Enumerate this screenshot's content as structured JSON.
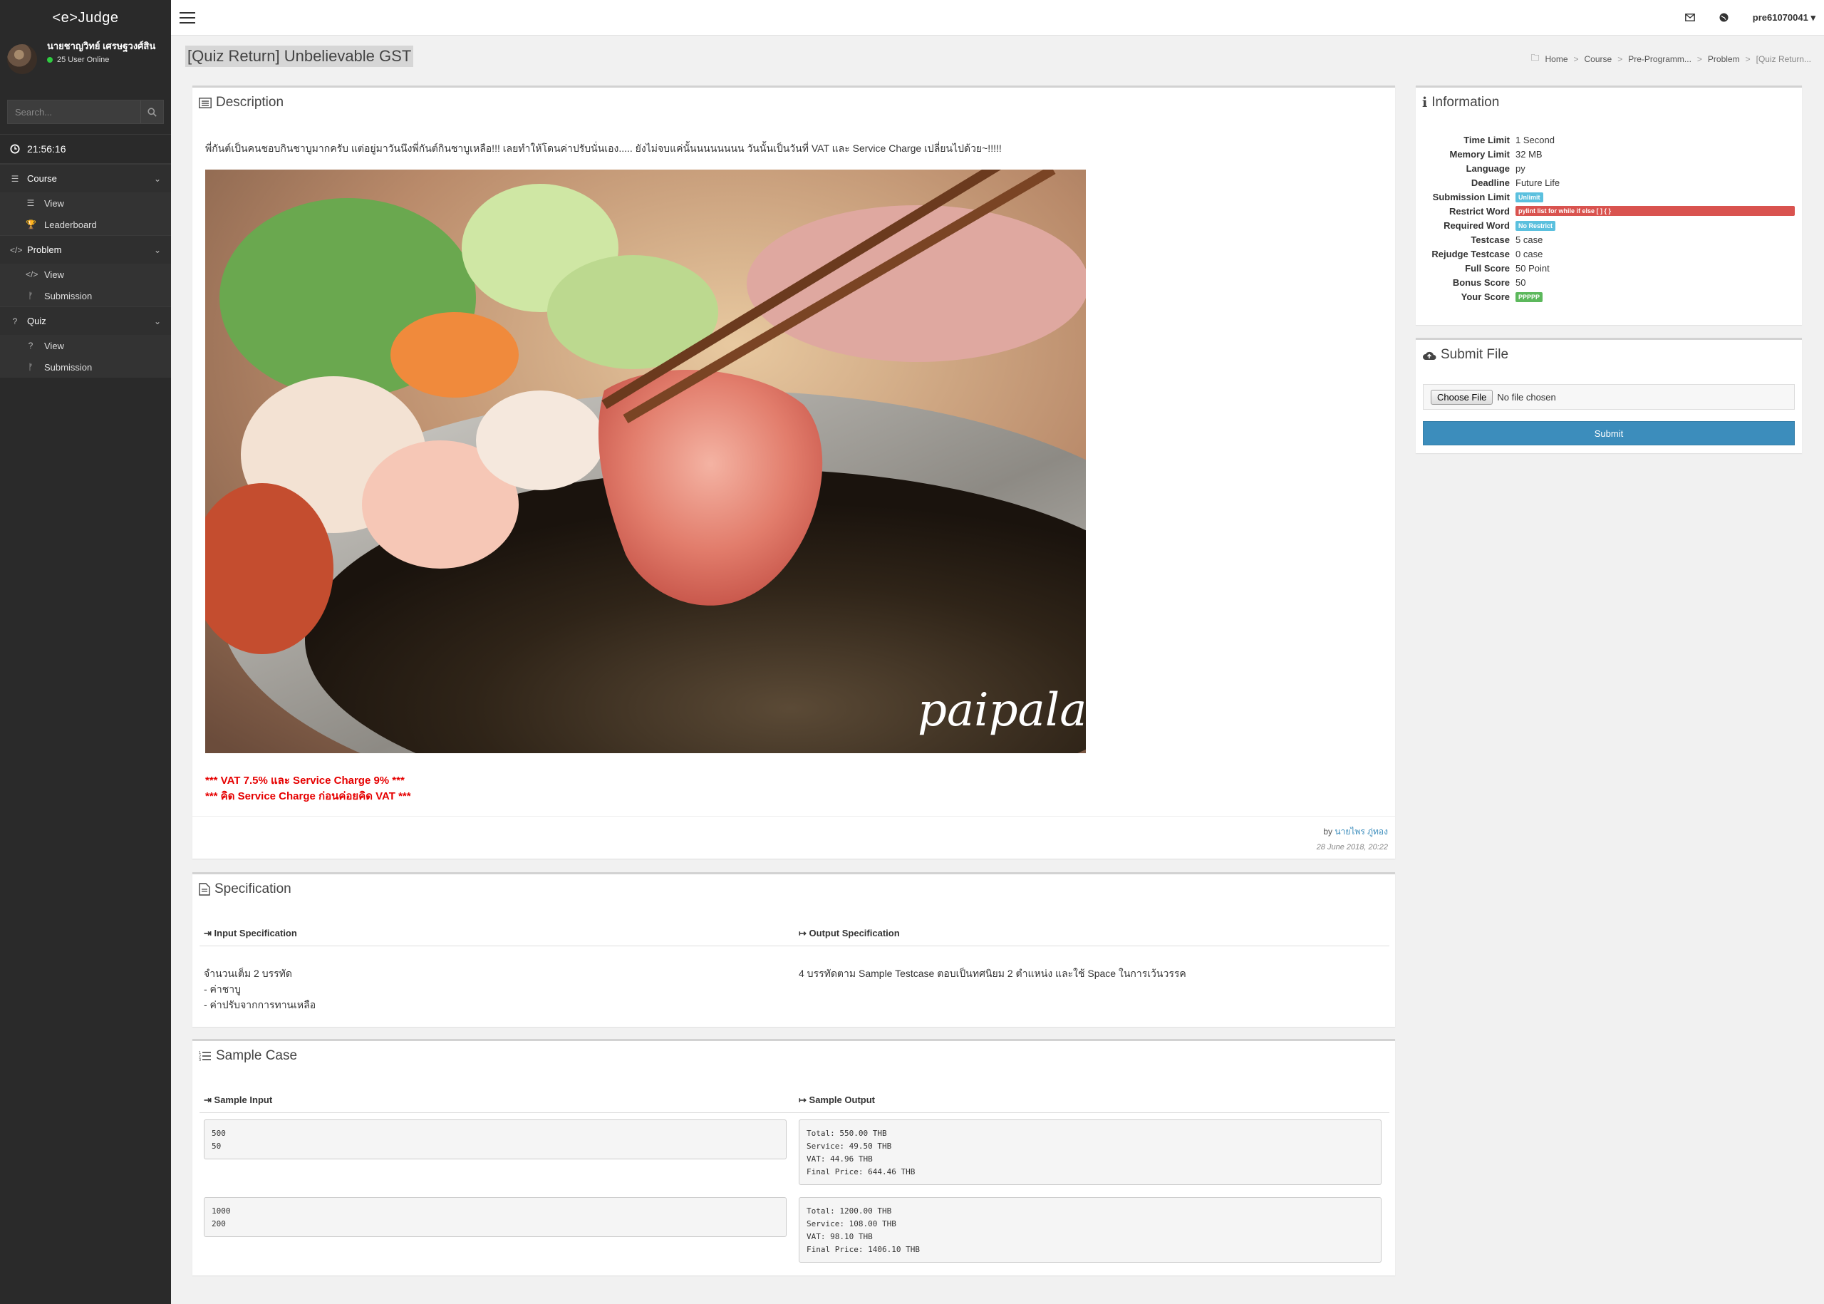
{
  "sidebar": {
    "brand": "<e>Judge",
    "user_name": "นายชาญวิทย์ เศรษฐวงศ์สิน",
    "online_text": "25 User Online",
    "search_placeholder": "Search...",
    "clock": "21:56:16",
    "sections": [
      {
        "label": "Course",
        "icon": "list-icon",
        "items": [
          {
            "label": "View",
            "icon": "list-icon"
          },
          {
            "label": "Leaderboard",
            "icon": "trophy-icon"
          }
        ]
      },
      {
        "label": "Problem",
        "icon": "code-icon",
        "items": [
          {
            "label": "View",
            "icon": "code-icon"
          },
          {
            "label": "Submission",
            "icon": "branch-icon"
          }
        ]
      },
      {
        "label": "Quiz",
        "icon": "question-icon",
        "items": [
          {
            "label": "View",
            "icon": "question-icon"
          },
          {
            "label": "Submission",
            "icon": "branch-icon"
          }
        ]
      }
    ]
  },
  "topbar": {
    "username": "pre61070041"
  },
  "page": {
    "title": "[Quiz Return] Unbelievable GST",
    "breadcrumb": [
      "Home",
      "Course",
      "Pre-Programm...",
      "Problem",
      "[Quiz Return..."
    ]
  },
  "description": {
    "heading": "Description",
    "text": "พี่กันต์เป็นคนชอบกินชาบูมากครับ แต่อยู่มาวันนึงพี่กันต์กินชาบูเหลือ!!! เลยทำให้โดนค่าปรับนั่นเอง..... ยังไม่จบแค่นั้นนนนนนนน วันนั้นเป็นวันที่ VAT และ Service Charge เปลี่ยนไปด้วย~!!!!!",
    "image_watermark": "paipala",
    "note1": "*** VAT 7.5% และ Service Charge 9% ***",
    "note2": "*** คิด Service Charge ก่อนค่อยคิด VAT ***",
    "by_prefix": "by",
    "author": "นายไพร ภู่ทอง",
    "date": "28 June 2018, 20:22"
  },
  "specification": {
    "heading": "Specification",
    "input_heading": "Input Specification",
    "output_heading": "Output Specification",
    "input_lines": [
      "จำนวนเต็ม 2 บรรทัด",
      "- ค่าชาบู",
      "- ค่าปรับจากการทานเหลือ"
    ],
    "output_text": "4 บรรทัดตาม Sample Testcase ตอบเป็นทศนิยม 2 ตำแหน่ง และใช้ Space ในการเว้นวรรค"
  },
  "sample": {
    "heading": "Sample Case",
    "input_heading": "Sample Input",
    "output_heading": "Sample Output",
    "cases": [
      {
        "input": "500\n50",
        "output": "Total: 550.00 THB\nService: 49.50 THB\nVAT: 44.96 THB\nFinal Price: 644.46 THB"
      },
      {
        "input": "1000\n200",
        "output": "Total: 1200.00 THB\nService: 108.00 THB\nVAT: 98.10 THB\nFinal Price: 1406.10 THB"
      }
    ]
  },
  "information": {
    "heading": "Information",
    "rows": [
      {
        "label": "Time Limit",
        "value": "1 Second"
      },
      {
        "label": "Memory Limit",
        "value": "32 MB"
      },
      {
        "label": "Language",
        "value": "py"
      },
      {
        "label": "Deadline",
        "value": "Future Life"
      },
      {
        "label": "Submission Limit",
        "badge": "Unlimit",
        "color": "#5bc0de"
      },
      {
        "label": "Restrict Word",
        "badge": "pylint list for while if else [ ] { }",
        "color": "#d9534f"
      },
      {
        "label": "Required Word",
        "badge": "No Restrict",
        "color": "#5bc0de"
      },
      {
        "label": "Testcase",
        "value": "5 case"
      },
      {
        "label": "Rejudge Testcase",
        "value": "0 case"
      },
      {
        "label": "Full Score",
        "value": "50 Point"
      },
      {
        "label": "Bonus Score",
        "value": "50"
      },
      {
        "label": "Your Score",
        "badge": "PPPPP",
        "color": "#5cb85c"
      }
    ]
  },
  "submit_file": {
    "heading": "Submit File",
    "choose_label": "Choose File",
    "no_file": "No file chosen",
    "submit_label": "Submit"
  }
}
